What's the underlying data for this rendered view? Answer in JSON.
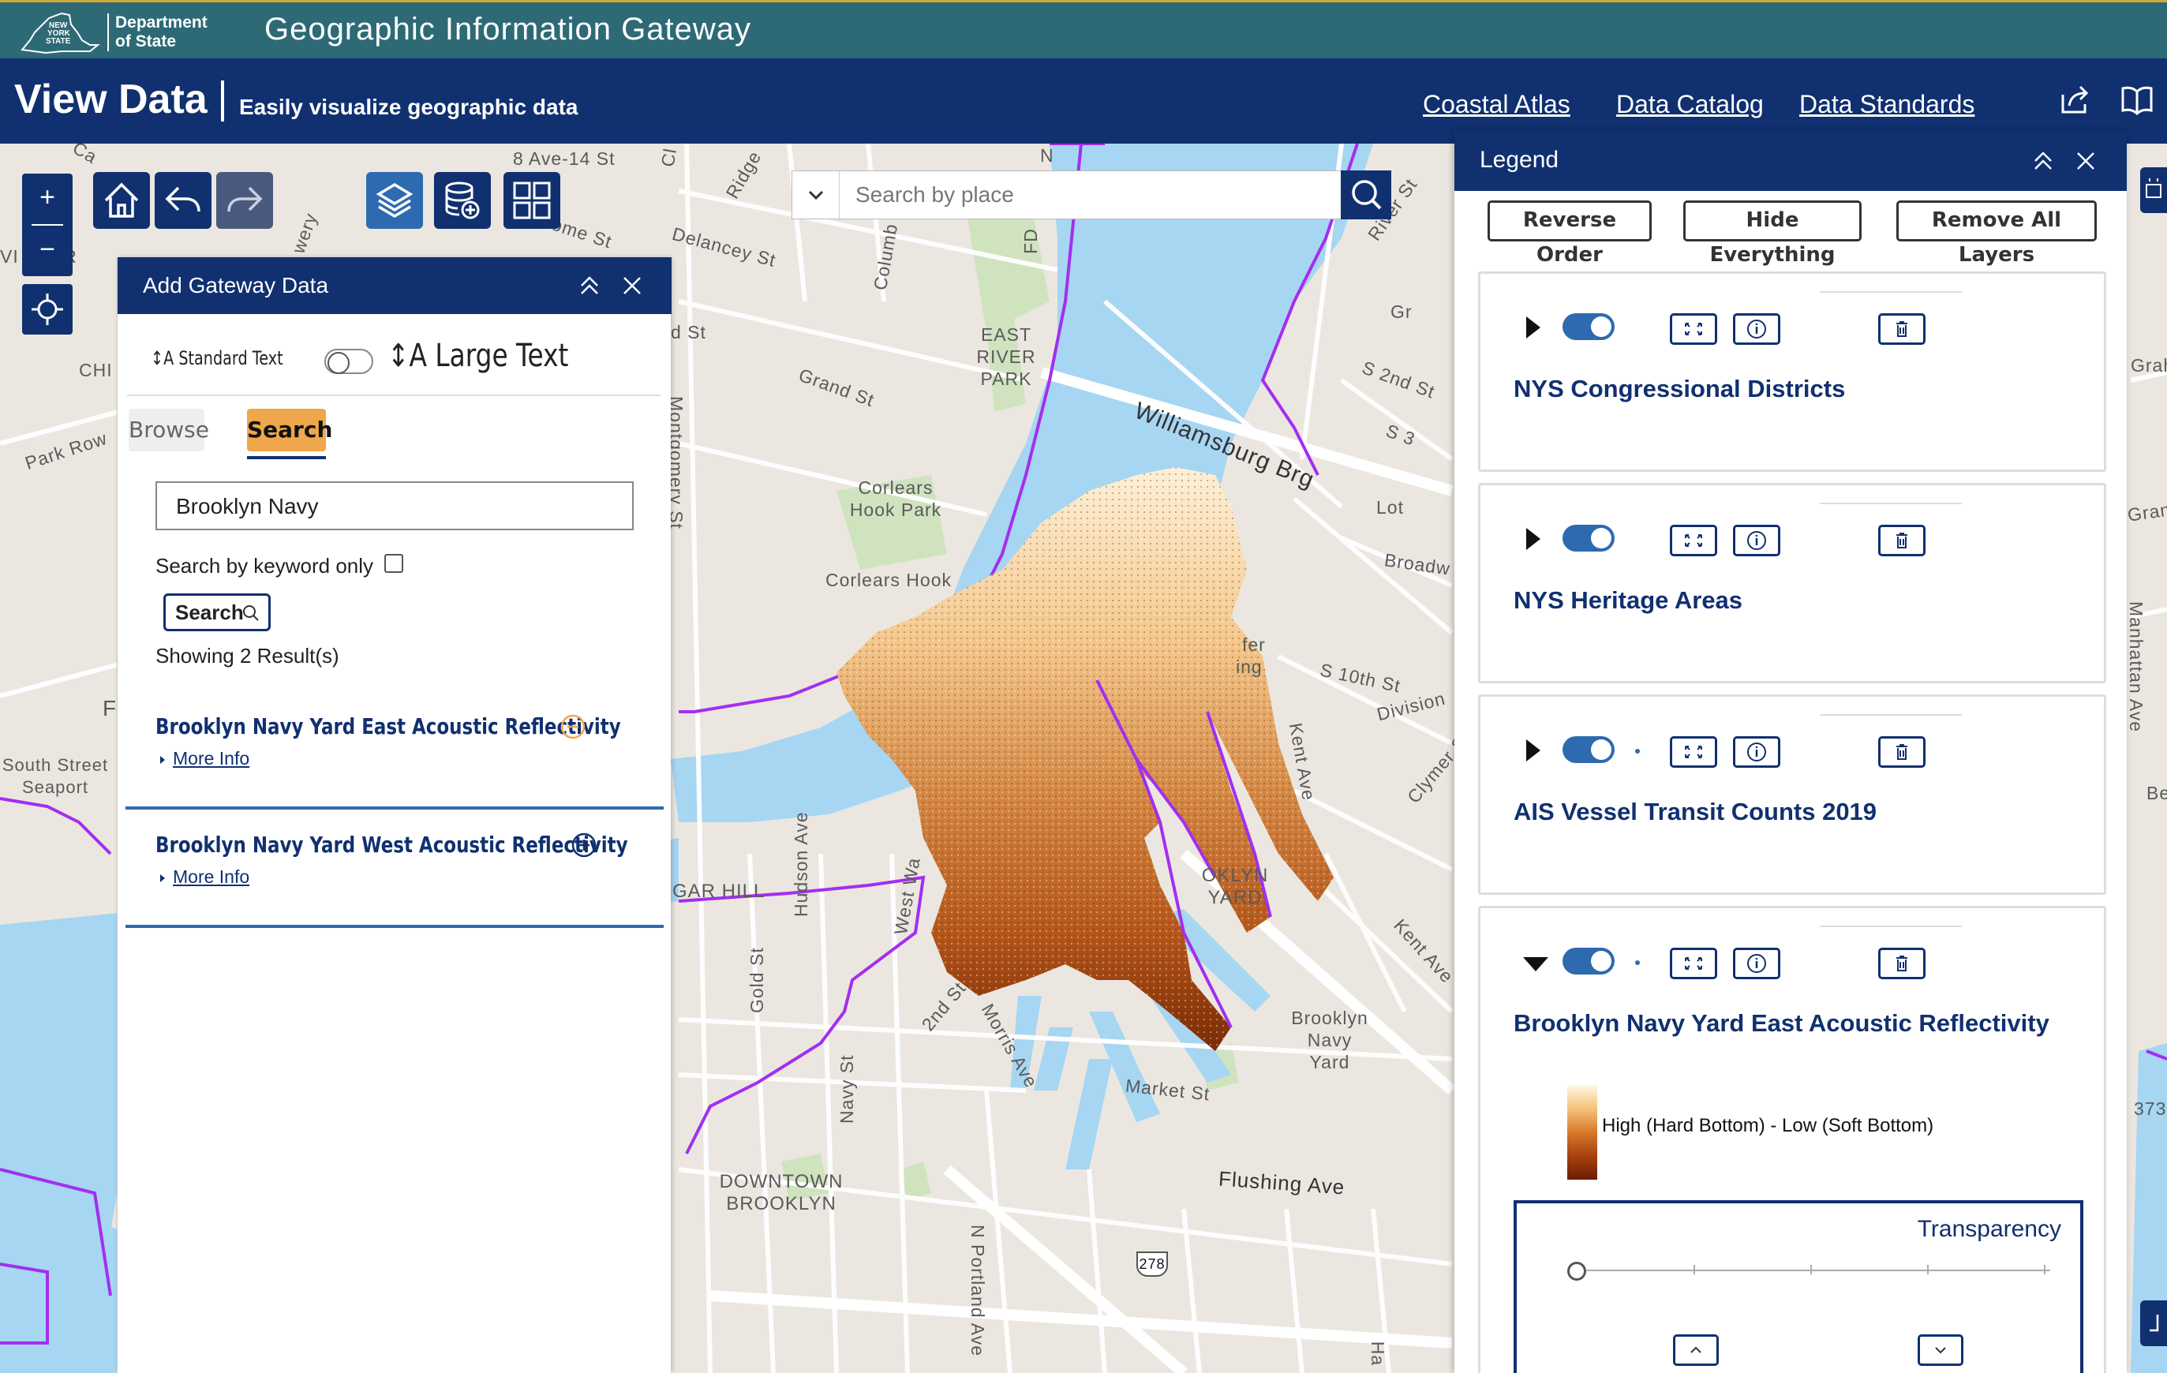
{
  "header": {
    "state_logo_text": "NEW YORK STATE",
    "dept_text": "Department of State",
    "site_title": "Geographic Information Gateway"
  },
  "nav": {
    "title": "View Data",
    "subtitle": "Easily visualize geographic data",
    "links": [
      "Coastal Atlas",
      "Data Catalog",
      "Data Standards"
    ],
    "icons": [
      "share-icon",
      "book-icon"
    ]
  },
  "map": {
    "search_placeholder": "Search by place",
    "zoom_in": "+",
    "zoom_out": "−",
    "labels": {
      "ave8": "8 Ave-14 St",
      "broome": "Broome St",
      "delancey": "Delancey St",
      "grand": "Grand St",
      "east_river_park": "EAST RIVER PARK",
      "williamsburg": "Williamsburg Brg",
      "corlears_park": "Corlears Hook Park",
      "corlears_hook": "Corlears Hook",
      "s2nd": "S 2nd St",
      "s10th": "S 10th St",
      "lot": "Lot",
      "broadway": "Broadw",
      "division": "Division",
      "kent": "Kent Ave",
      "kent2": "Kent Ave",
      "clymer": "Clymer S",
      "navy_yard_caps": "OKLYN YARD",
      "bny": "Brooklyn Navy Yard",
      "hudson": "Hudson Ave",
      "gold": "Gold St",
      "vinegar": "GAR HILL",
      "downtown": "DOWNTOWN BROOKLYN",
      "flushing": "Flushing Ave",
      "market": "Market St",
      "morris": "Morris Ave",
      "second": "2nd St",
      "navy_st": "Navy St",
      "portland": "N Portland Ave",
      "south_street": "South Street Seaport",
      "park_row": "Park Row",
      "chi": "CHI",
      "vinter": "VI NTER",
      "ridge": "Ridge",
      "columbia": "Columb",
      "bowery": "wery",
      "fd": "FD",
      "river_st": "River St",
      "manhattan": "Manhattan Ave",
      "montgomery": "Montgomery St",
      "west_wa": "West Wa",
      "gra": "Grah",
      "gran": "Gran",
      "num373": "373",
      "shield": "278",
      "ca": "Ca",
      "cl": "Cl",
      "d_st": "d St",
      "s3": "S 3",
      "gr": "Gr",
      "ha": "Ha",
      "n": "N",
      "ing": "ing",
      "fer": "fer",
      "be": "Be",
      "f": "F"
    }
  },
  "gateway_panel": {
    "title": "Add Gateway Data",
    "standard_text": "↕A Standard Text",
    "large_text": "↕A Large Text",
    "tabs": [
      "Browse",
      "Search"
    ],
    "active_tab": "Search",
    "keyword_value": "Brooklyn Navy",
    "keyword_only_label": "Search by keyword only",
    "search_button": "Search",
    "showing": "Showing 2 Result(s)",
    "results": [
      {
        "title": "Brooklyn Navy Yard East Acoustic Reflectivity",
        "more": "More Info",
        "state": "added"
      },
      {
        "title": "Brooklyn Navy Yard West Acoustic Reflectivity",
        "more": "More Info",
        "state": "not-added"
      }
    ]
  },
  "legend": {
    "title": "Legend",
    "actions": [
      "Reverse Order",
      "Hide Everything",
      "Remove All Layers"
    ],
    "layers": [
      {
        "name": "NYS Congressional Districts",
        "expanded": false
      },
      {
        "name": "NYS Heritage Areas",
        "expanded": false
      },
      {
        "name": "AIS Vessel Transit Counts 2019",
        "expanded": false
      },
      {
        "name": "Brooklyn Navy Yard East Acoustic Reflectivity",
        "expanded": true
      }
    ],
    "ramp_label": "High (Hard Bottom) - Low (Soft Bottom)",
    "transparency_label": "Transparency",
    "transparency_value": 0,
    "colors": {
      "navy": "#103070",
      "teal": "#2d6a76",
      "accent": "#2d6ab0",
      "search_tab": "#f0a64a",
      "district_line": "#a32ef0",
      "water": "#a6d6f2"
    }
  }
}
